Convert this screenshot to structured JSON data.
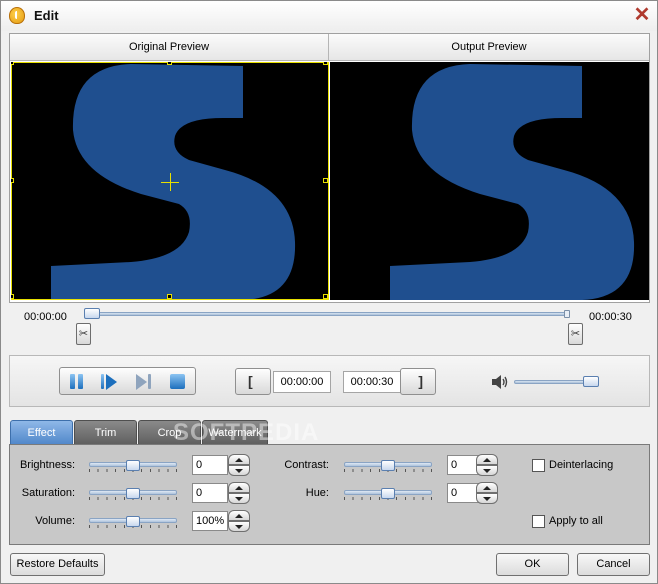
{
  "window": {
    "title": "Edit",
    "app_icon": "app-icon",
    "close_icon": "close-icon"
  },
  "preview": {
    "original_label": "Original Preview",
    "output_label": "Output Preview",
    "letter": "S",
    "letter_color": "#1f4f8f"
  },
  "timeline": {
    "start_time": "00:00:00",
    "end_time": "00:00:30",
    "position": 0.0
  },
  "playback": {
    "buttons": [
      "pause-icon",
      "play-icon",
      "next-frame-icon",
      "stop-icon"
    ],
    "start_bracket": "[",
    "end_bracket": "]",
    "start_value": "00:00:00",
    "end_value": "00:00:30",
    "volume_icon": "speaker-icon",
    "volume_level": 0.9
  },
  "tabs": [
    {
      "label": "Effect",
      "active": true
    },
    {
      "label": "Trim",
      "active": false
    },
    {
      "label": "Crop",
      "active": false
    },
    {
      "label": "Watermark",
      "active": false
    }
  ],
  "watermark_text": "SOFTPEDIA",
  "effect": {
    "brightness": {
      "label": "Brightness:",
      "value": "0",
      "level": 0.5
    },
    "saturation": {
      "label": "Saturation:",
      "value": "0",
      "level": 0.5
    },
    "volume": {
      "label": "Volume:",
      "value": "100%",
      "level": 0.5
    },
    "contrast": {
      "label": "Contrast:",
      "value": "0",
      "level": 0.5
    },
    "hue": {
      "label": "Hue:",
      "value": "0",
      "level": 0.5
    },
    "deinterlacing": {
      "label": "Deinterlacing",
      "checked": false
    },
    "apply_to_all": {
      "label": "Apply to all",
      "checked": false
    }
  },
  "footer": {
    "restore_label": "Restore Defaults",
    "ok_label": "OK",
    "cancel_label": "Cancel"
  },
  "colors": {
    "accent": "#4f86c9",
    "crop_border": "#e8e000",
    "video_bg": "#000000"
  }
}
